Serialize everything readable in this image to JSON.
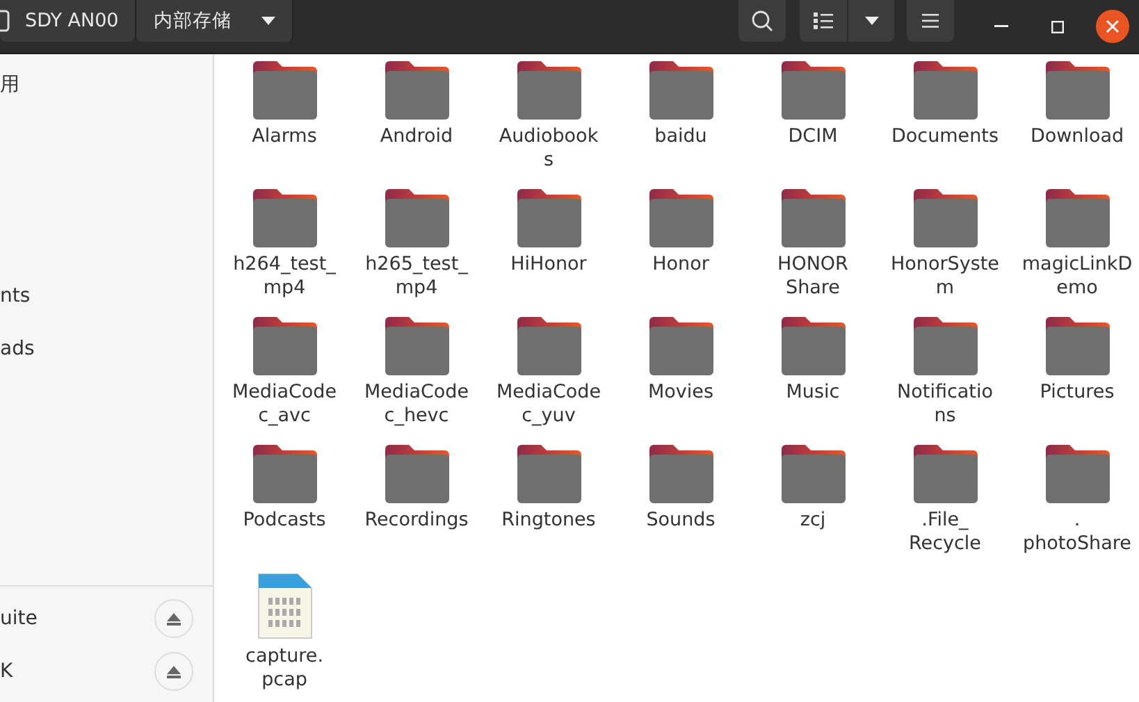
{
  "header": {
    "device": "SDY AN00",
    "location": "内部存储"
  },
  "sidebar": {
    "places": [
      {
        "label": "用"
      },
      {
        "label": "nts"
      },
      {
        "label": "ads"
      }
    ],
    "devices": [
      {
        "label": "uite"
      },
      {
        "label": "K"
      }
    ]
  },
  "files": [
    {
      "kind": "folder",
      "name": "Alarms"
    },
    {
      "kind": "folder",
      "name": "Android"
    },
    {
      "kind": "folder",
      "name": "Audiobook\ns"
    },
    {
      "kind": "folder",
      "name": "baidu"
    },
    {
      "kind": "folder",
      "name": "DCIM"
    },
    {
      "kind": "folder",
      "name": "Documents"
    },
    {
      "kind": "folder",
      "name": "Download"
    },
    {
      "kind": "folder",
      "name": "h264_test_\nmp4"
    },
    {
      "kind": "folder",
      "name": "h265_test_\nmp4"
    },
    {
      "kind": "folder",
      "name": "HiHonor"
    },
    {
      "kind": "folder",
      "name": "Honor"
    },
    {
      "kind": "folder",
      "name": "HONOR\nShare"
    },
    {
      "kind": "folder",
      "name": "HonorSyste\nm"
    },
    {
      "kind": "folder",
      "name": "magicLinkD\nemo"
    },
    {
      "kind": "folder",
      "name": "MediaCode\nc_avc"
    },
    {
      "kind": "folder",
      "name": "MediaCode\nc_hevc"
    },
    {
      "kind": "folder",
      "name": "MediaCode\nc_yuv"
    },
    {
      "kind": "folder",
      "name": "Movies"
    },
    {
      "kind": "folder",
      "name": "Music"
    },
    {
      "kind": "folder",
      "name": "Notificatio\nns"
    },
    {
      "kind": "folder",
      "name": "Pictures"
    },
    {
      "kind": "folder",
      "name": "Podcasts"
    },
    {
      "kind": "folder",
      "name": "Recordings"
    },
    {
      "kind": "folder",
      "name": "Ringtones"
    },
    {
      "kind": "folder",
      "name": "Sounds"
    },
    {
      "kind": "folder",
      "name": "zcj"
    },
    {
      "kind": "folder",
      "name": ".File_\nRecycle"
    },
    {
      "kind": "folder",
      "name": ".\nphotoShare"
    },
    {
      "kind": "binary",
      "name": "capture.\npcap"
    }
  ]
}
